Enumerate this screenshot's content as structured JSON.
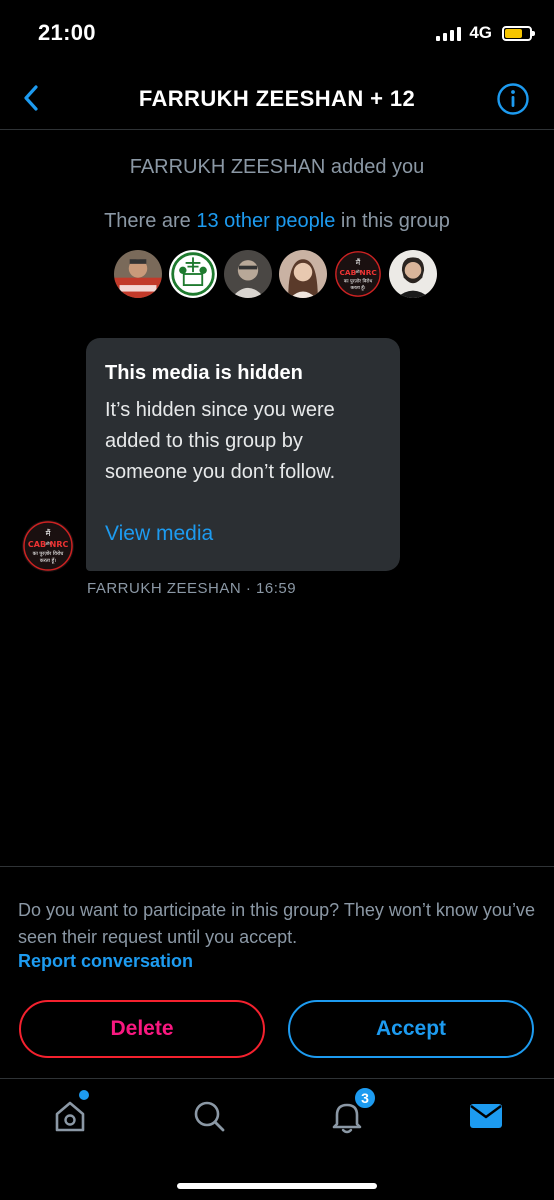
{
  "status_bar": {
    "time": "21:00",
    "network": "4G"
  },
  "header": {
    "title": "FARRUKH ZEESHAN + 12"
  },
  "conversation": {
    "added_text": "FARRUKH ZEESHAN added you",
    "people_prefix": "There are ",
    "people_link": "13 other people",
    "people_suffix": " in this group"
  },
  "message": {
    "title": "This media is hidden",
    "body": "It’s hidden since you were added to this group by someone you don’t follow.",
    "link": "View media",
    "sender": "FARRUKH ZEESHAN",
    "separator": " · ",
    "time": "16:59"
  },
  "avatar_badge": {
    "line1": "मैं",
    "cab": "CAB",
    "and": "और",
    "nrc": "NRC",
    "line3": "का पुरज़ोर विरोध",
    "line4": "करता हूँ।"
  },
  "request": {
    "text": "Do you want to participate in this group? They won’t know you’ve seen their request until you accept.",
    "report_link": "Report conversation",
    "delete_label": "Delete",
    "accept_label": "Accept"
  },
  "tab_bar": {
    "notifications_count": "3"
  },
  "colors": {
    "accent": "#1d9bf0",
    "danger": "#f91880",
    "muted": "#8b98a5",
    "bubble": "#2b2f33"
  },
  "icons": [
    "back-chevron-icon",
    "info-icon",
    "home-icon",
    "search-icon",
    "bell-icon",
    "mail-icon"
  ]
}
